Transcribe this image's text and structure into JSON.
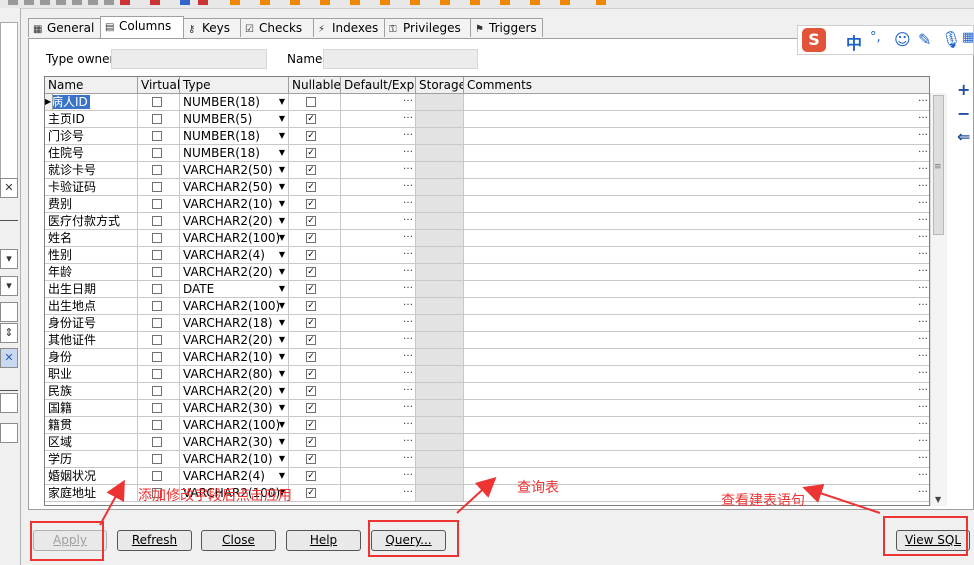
{
  "tabs": [
    {
      "label": "General",
      "icon": "general-tab-icon"
    },
    {
      "label": "Columns",
      "icon": "columns-tab-icon"
    },
    {
      "label": "Keys",
      "icon": "keys-tab-icon"
    },
    {
      "label": "Checks",
      "icon": "checks-tab-icon"
    },
    {
      "label": "Indexes",
      "icon": "indexes-tab-icon"
    },
    {
      "label": "Privileges",
      "icon": "privileges-tab-icon"
    },
    {
      "label": "Triggers",
      "icon": "triggers-tab-icon"
    }
  ],
  "active_tab": "Columns",
  "form": {
    "type_owner_label": "Type owner",
    "type_owner_value": "",
    "name_label": "Name",
    "name_value": ""
  },
  "grid": {
    "headers": [
      "Name",
      "Virtual",
      "Type",
      "Nullable",
      "Default/Expr.",
      "Storage",
      "Comments"
    ],
    "rows": [
      {
        "name": "病人ID",
        "virtual": false,
        "type": "NUMBER(18)",
        "nullable": false
      },
      {
        "name": "主页ID",
        "virtual": false,
        "type": "NUMBER(5)",
        "nullable": true
      },
      {
        "name": "门诊号",
        "virtual": false,
        "type": "NUMBER(18)",
        "nullable": true
      },
      {
        "name": "住院号",
        "virtual": false,
        "type": "NUMBER(18)",
        "nullable": true
      },
      {
        "name": "就诊卡号",
        "virtual": false,
        "type": "VARCHAR2(50)",
        "nullable": true
      },
      {
        "name": "卡验证码",
        "virtual": false,
        "type": "VARCHAR2(50)",
        "nullable": true
      },
      {
        "name": "费别",
        "virtual": false,
        "type": "VARCHAR2(10)",
        "nullable": true
      },
      {
        "name": "医疗付款方式",
        "virtual": false,
        "type": "VARCHAR2(20)",
        "nullable": true
      },
      {
        "name": "姓名",
        "virtual": false,
        "type": "VARCHAR2(100)",
        "nullable": true
      },
      {
        "name": "性别",
        "virtual": false,
        "type": "VARCHAR2(4)",
        "nullable": true
      },
      {
        "name": "年龄",
        "virtual": false,
        "type": "VARCHAR2(20)",
        "nullable": true
      },
      {
        "name": "出生日期",
        "virtual": false,
        "type": "DATE",
        "nullable": true
      },
      {
        "name": "出生地点",
        "virtual": false,
        "type": "VARCHAR2(100)",
        "nullable": true
      },
      {
        "name": "身份证号",
        "virtual": false,
        "type": "VARCHAR2(18)",
        "nullable": true
      },
      {
        "name": "其他证件",
        "virtual": false,
        "type": "VARCHAR2(20)",
        "nullable": true
      },
      {
        "name": "身份",
        "virtual": false,
        "type": "VARCHAR2(10)",
        "nullable": true
      },
      {
        "name": "职业",
        "virtual": false,
        "type": "VARCHAR2(80)",
        "nullable": true
      },
      {
        "name": "民族",
        "virtual": false,
        "type": "VARCHAR2(20)",
        "nullable": true
      },
      {
        "name": "国籍",
        "virtual": false,
        "type": "VARCHAR2(30)",
        "nullable": true
      },
      {
        "name": "籍贯",
        "virtual": false,
        "type": "VARCHAR2(100)",
        "nullable": true
      },
      {
        "name": "区域",
        "virtual": false,
        "type": "VARCHAR2(30)",
        "nullable": true
      },
      {
        "name": "学历",
        "virtual": false,
        "type": "VARCHAR2(10)",
        "nullable": true
      },
      {
        "name": "婚姻状况",
        "virtual": false,
        "type": "VARCHAR2(4)",
        "nullable": true
      },
      {
        "name": "家庭地址",
        "virtual": false,
        "type": "VARCHAR2(100)",
        "nullable": true
      }
    ]
  },
  "buttons": {
    "apply": "Apply",
    "refresh": "Refresh",
    "close": "Close",
    "help": "Help",
    "query": "Query...",
    "view_sql": "View SQL"
  },
  "annotations": {
    "apply_note": "添加修改字段后点击应用",
    "query_note": "查询表",
    "view_sql_note": "查看建表语句",
    "color": "#e33333"
  },
  "ime": {
    "logo": "S",
    "mode": "中"
  },
  "colors": {
    "selection": "#3a74c8",
    "panel_bg": "#f0f0f0",
    "storage_cell": "#e3e3e3"
  }
}
